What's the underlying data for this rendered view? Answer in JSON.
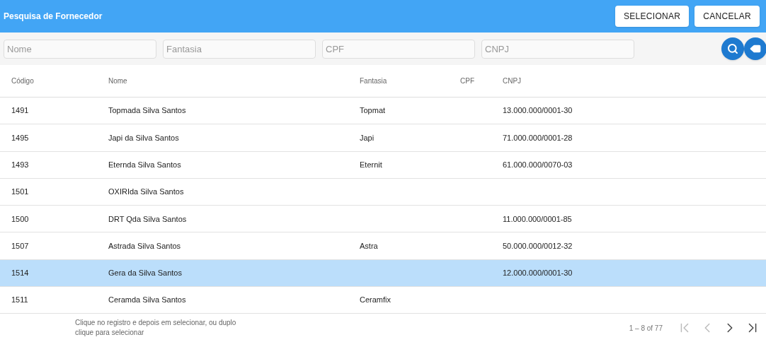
{
  "header": {
    "title": "Pesquisa de Fornecedor",
    "buttons": [
      "SELECIONAR",
      "CANCELAR"
    ]
  },
  "filters": [
    {
      "placeholder": "Nome"
    },
    {
      "placeholder": "Fantasia"
    },
    {
      "placeholder": "CPF"
    },
    {
      "placeholder": "CNPJ"
    }
  ],
  "table": {
    "columns": [
      "Código",
      "Nome",
      "Fantasia",
      "CPF",
      "CNPJ"
    ],
    "rows": [
      {
        "codigo": "1491",
        "nome": "Topmada Silva Santos",
        "fantasia": "Topmat",
        "cpf": "",
        "cnpj": "13.000.000/0001-30",
        "selected": false
      },
      {
        "codigo": "1495",
        "nome": "Japi da Silva Santos",
        "fantasia": "Japi",
        "cpf": "",
        "cnpj": "71.000.000/0001-28",
        "selected": false
      },
      {
        "codigo": "1493",
        "nome": "Eternda Silva Santos",
        "fantasia": "Eternit",
        "cpf": "",
        "cnpj": "61.000.000/0070-03",
        "selected": false
      },
      {
        "codigo": "1501",
        "nome": "OXIRIda Silva Santos",
        "fantasia": "",
        "cpf": "",
        "cnpj": "",
        "selected": false
      },
      {
        "codigo": "1500",
        "nome": "DRT Qda Silva Santos",
        "fantasia": "",
        "cpf": "",
        "cnpj": "11.000.000/0001-85",
        "selected": false
      },
      {
        "codigo": "1507",
        "nome": "Astrada Silva Santos",
        "fantasia": "Astra",
        "cpf": "",
        "cnpj": "50.000.000/0012-32",
        "selected": false
      },
      {
        "codigo": "1514",
        "nome": "Gera da Silva Santos",
        "fantasia": "",
        "cpf": "",
        "cnpj": "12.000.000/0001-30",
        "selected": true
      },
      {
        "codigo": "1511",
        "nome": "Ceramda Silva Santos",
        "fantasia": "Ceramfix",
        "cpf": "",
        "cnpj": "",
        "selected": false
      }
    ]
  },
  "footer": {
    "hint": "Clique no registro e depois em selecionar, ou duplo clique para selecionar",
    "range": "1 – 8 of 77",
    "pager": [
      {
        "kind": "first",
        "disabled": true
      },
      {
        "kind": "prev",
        "disabled": true
      },
      {
        "kind": "next",
        "disabled": false
      },
      {
        "kind": "last",
        "disabled": false
      }
    ]
  }
}
